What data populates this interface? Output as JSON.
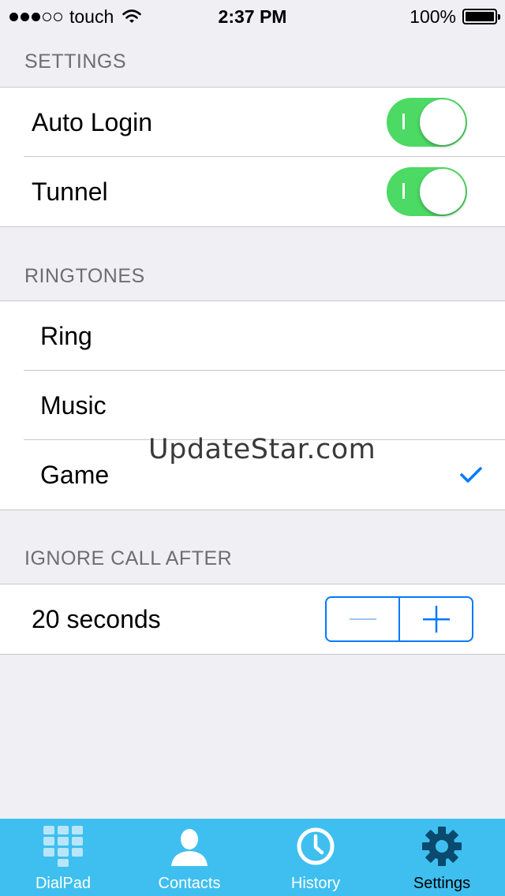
{
  "status_bar": {
    "carrier": "touch",
    "time": "2:37 PM",
    "battery_percent": "100%"
  },
  "sections": {
    "settings": {
      "header": "SETTINGS",
      "rows": [
        {
          "label": "Auto Login",
          "toggle_on": true
        },
        {
          "label": "Tunnel",
          "toggle_on": true
        }
      ]
    },
    "ringtones": {
      "header": "RINGTONES",
      "rows": [
        {
          "label": "Ring",
          "selected": false
        },
        {
          "label": "Music",
          "selected": false
        },
        {
          "label": "Game",
          "selected": true
        }
      ]
    },
    "ignore_call": {
      "header": "IGNORE CALL AFTER",
      "value": "20 seconds"
    }
  },
  "watermark": "UpdateStar.com",
  "tab_bar": {
    "tabs": [
      {
        "label": "DialPad",
        "icon": "dialpad-icon"
      },
      {
        "label": "Contacts",
        "icon": "contacts-icon"
      },
      {
        "label": "History",
        "icon": "clock-icon"
      },
      {
        "label": "Settings",
        "icon": "gear-icon"
      }
    ],
    "active": "Settings"
  },
  "colors": {
    "background": "#efeff4",
    "toggle_on": "#4cd964",
    "accent": "#007aff",
    "tab_bar": "#3ebff0",
    "section_header": "#6d6d72"
  }
}
